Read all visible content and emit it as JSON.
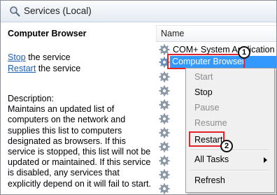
{
  "window": {
    "title": "Services (Local)",
    "title_icon": "magnifier-gear-icon"
  },
  "left_pane": {
    "service_name": "Computer Browser",
    "actions": [
      {
        "link": "Stop",
        "suffix": " the service"
      },
      {
        "link": "Restart",
        "suffix": " the service"
      }
    ],
    "description_label": "Description:",
    "description_text": "Maintains an updated list of computers on the network and supplies this list to computers designated as browsers. If this service is stopped, this list will not be updated or maintained. If this service is disabled, any services that explicitly depend on it will fail to start."
  },
  "right_pane": {
    "column_header": "Name",
    "rows": [
      {
        "name": "COM+ System Application",
        "icon": "gear-icon"
      },
      {
        "name": "Computer Browser",
        "icon": "gear-icon",
        "selected": true
      }
    ]
  },
  "context_menu": {
    "items": [
      {
        "label": "Start",
        "enabled": false
      },
      {
        "label": "Stop",
        "enabled": true
      },
      {
        "label": "Pause",
        "enabled": false
      },
      {
        "label": "Resume",
        "enabled": false
      },
      {
        "label": "Restart",
        "enabled": true
      },
      {
        "label": "All Tasks",
        "enabled": true,
        "submenu": true
      },
      {
        "label": "Refresh",
        "enabled": true
      }
    ]
  },
  "callouts": [
    {
      "number": "1"
    },
    {
      "number": "2"
    }
  ],
  "colors": {
    "selection": "#3399ff",
    "callout_border": "#e0242a",
    "link": "#1a5fb4"
  }
}
